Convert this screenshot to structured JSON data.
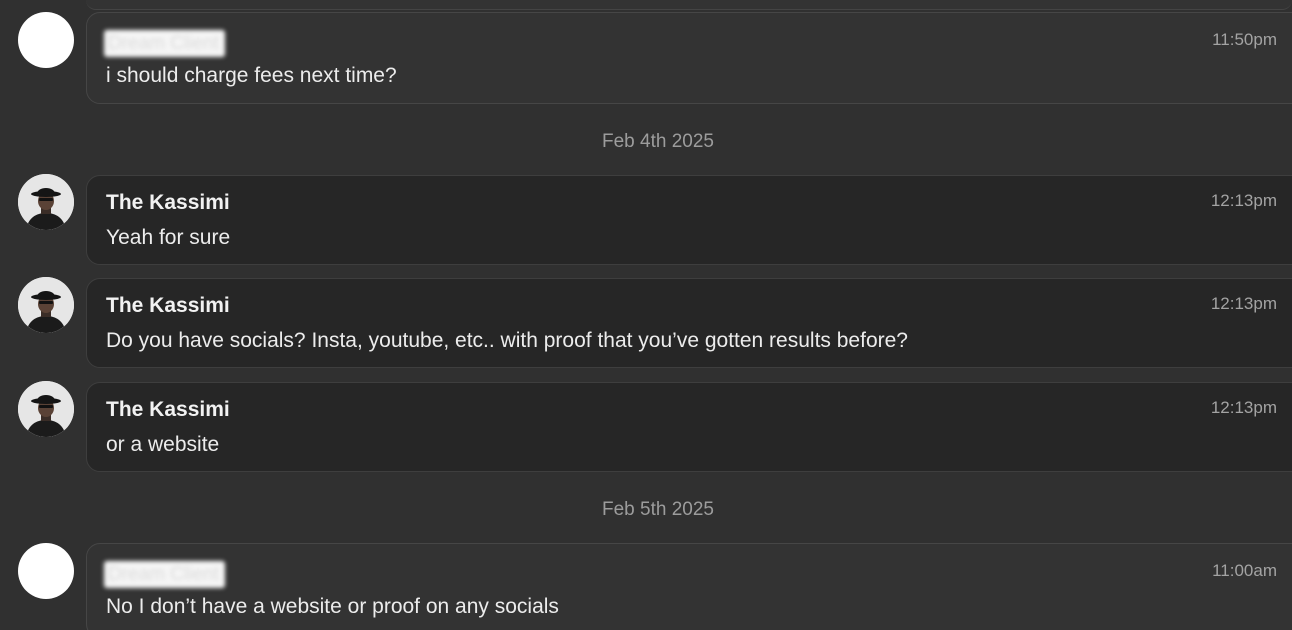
{
  "messages": [
    {
      "sender": "Dream Client",
      "sender_redacted": true,
      "text": "i should charge fees next time?",
      "time": "11:50pm",
      "avatar": "blank-avatar"
    },
    {
      "sender": "The Kassimi",
      "sender_redacted": false,
      "text": "Yeah for sure",
      "time": "12:13pm",
      "avatar": "person-hat-avatar"
    },
    {
      "sender": "The Kassimi",
      "sender_redacted": false,
      "text": "Do you have socials? Insta, youtube, etc.. with proof that you’ve gotten results before?",
      "time": "12:13pm",
      "avatar": "person-hat-avatar"
    },
    {
      "sender": "The Kassimi",
      "sender_redacted": false,
      "text": "or a website",
      "time": "12:13pm",
      "avatar": "person-hat-avatar"
    },
    {
      "sender": "Dream Client",
      "sender_redacted": true,
      "text": "No I don’t have a website or proof on any socials",
      "time": "11:00am",
      "avatar": "blank-avatar"
    }
  ],
  "dividers": [
    "Feb 4th 2025",
    "Feb 5th 2025"
  ],
  "colors": {
    "background": "#303030",
    "own_bubble": "#333333",
    "other_bubble": "#262626",
    "timestamp": "#a3a3a3",
    "divider_text": "#9c9c9c"
  }
}
